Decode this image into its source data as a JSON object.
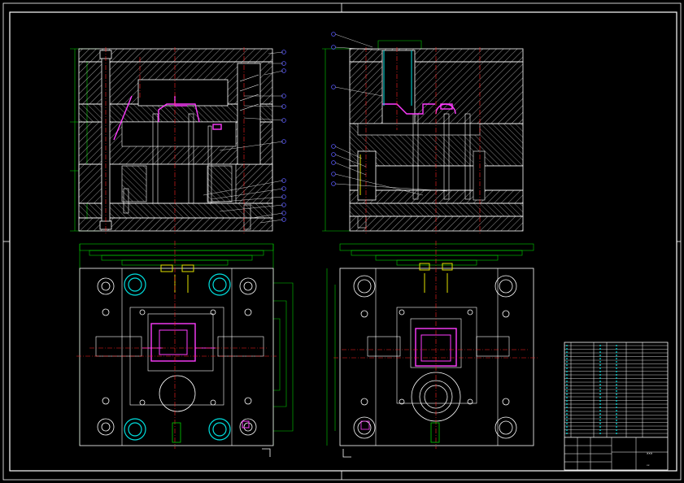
{
  "colors": {
    "background": "#000000",
    "outline": "#ffffff",
    "hatch": "#ffffff",
    "dimension": "#00d000",
    "centerline": "#ff2020",
    "part": "#ff3cff",
    "balloon": "#5a5aff",
    "cyan": "#00e0e0",
    "yellow": "#e0e000"
  },
  "title_block": {
    "name_code": "×××",
    "scale_code": "××"
  },
  "balloon_icon": "circle-marker-icon"
}
